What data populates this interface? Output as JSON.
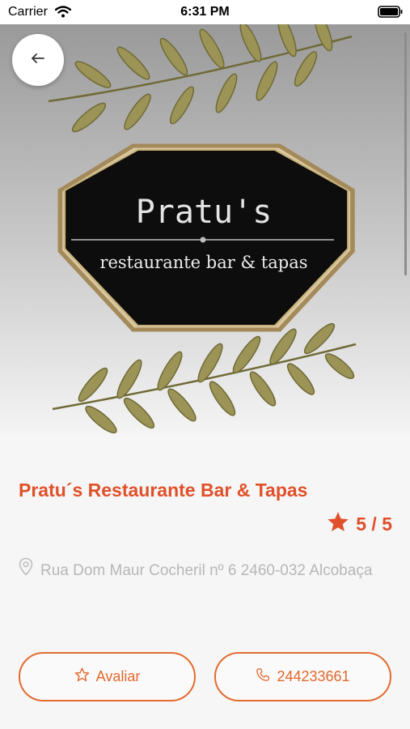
{
  "status_bar": {
    "carrier": "Carrier",
    "time": "6:31 PM"
  },
  "hero": {
    "logo_name": "Pratu's",
    "logo_tagline": "restaurante bar & tapas"
  },
  "restaurant": {
    "name": "Pratu´s Restaurante Bar & Tapas",
    "rating": "5 / 5",
    "address": "Rua Dom Maur Cocheril nº 6 2460-032 Alcobaça"
  },
  "actions": {
    "rate_label": "Avaliar",
    "phone_label": "244233661"
  },
  "icons": {
    "back": "arrow-left-icon",
    "rating": "star-icon",
    "address": "map-pin-icon",
    "rate": "star-outline-icon",
    "phone": "phone-icon"
  },
  "colors": {
    "accent": "#e0502a",
    "button_border": "#e36b2f",
    "muted_text": "#b7b7b7"
  }
}
